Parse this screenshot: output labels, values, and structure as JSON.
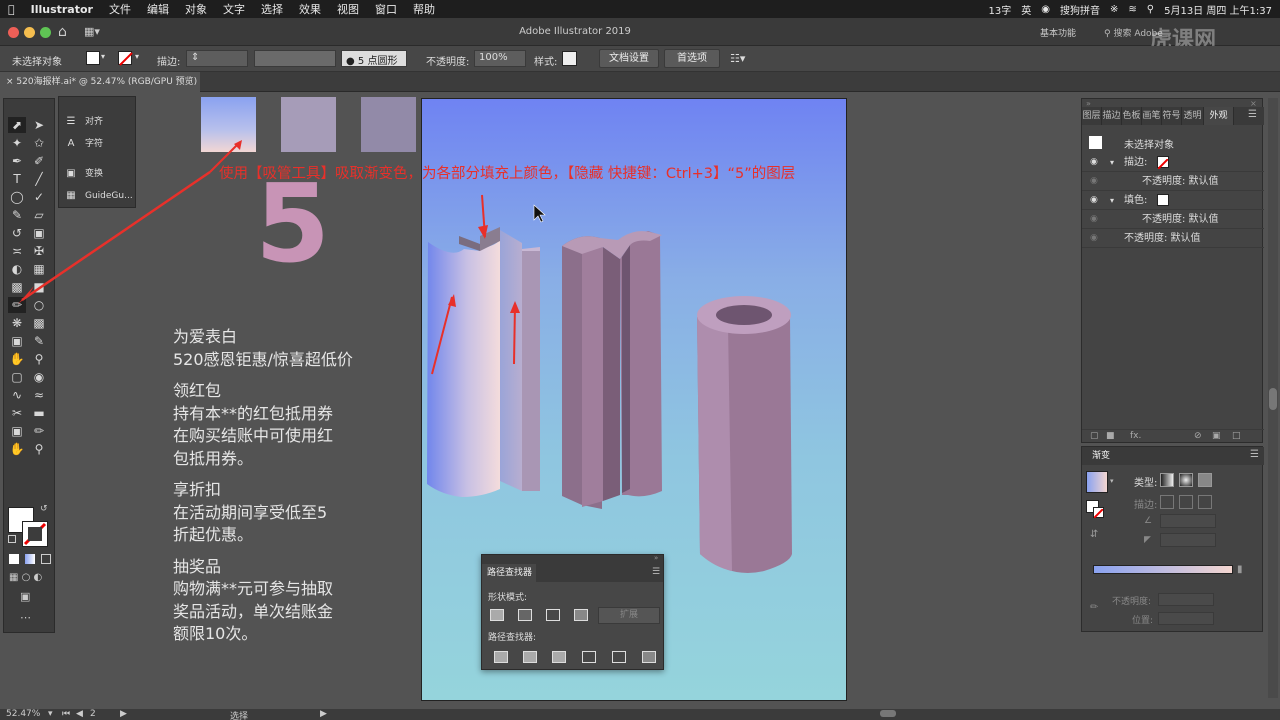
{
  "menubar": {
    "app": "Illustrator",
    "items": [
      "文件",
      "编辑",
      "对象",
      "文字",
      "选择",
      "效果",
      "视图",
      "窗口",
      "帮助"
    ],
    "status_input": "13字",
    "status_lang": "英",
    "sogou": "搜狗拼音",
    "datetime": "5月13日 周四 上午1:37"
  },
  "window": {
    "title": "Adobe Illustrator 2019",
    "workspace": "基本功能",
    "search_placeholder": "搜索 Adobe"
  },
  "control_bar": {
    "selection": "未选择对象",
    "stroke_label": "描边:",
    "brush": "5 点圆形",
    "opacity_label": "不透明度:",
    "opacity_value": "100%",
    "style_label": "样式:",
    "doc_setup": "文档设置",
    "preferences": "首选项"
  },
  "doc_tab": {
    "label": "520海报样.ai* @ 52.47% (RGB/GPU 预览)"
  },
  "flyout": {
    "items": [
      {
        "icon": "align-icon",
        "label": "对齐"
      },
      {
        "icon": "character-icon",
        "label": "字符"
      },
      {
        "icon": "transform-icon",
        "label": "变换"
      },
      {
        "icon": "guide-icon",
        "label": "GuideGu..."
      }
    ]
  },
  "artwork": {
    "big_number": "5",
    "swatch_colors": [
      "#8aa2f0",
      "#a69cb8",
      "#928aa8"
    ]
  },
  "annotation": "使用【吸管工具】吸取渐变色，为各部分填充上颜色，【隐藏 快捷键：Ctrl+3】“5”的图层",
  "poster_text": [
    {
      "lines": [
        "为爱表白",
        "520感恩钜惠/惊喜超低价"
      ]
    },
    {
      "lines": [
        "领红包",
        "持有本**的红包抵用券",
        "在购买结账中可使用红",
        "包抵用券。"
      ]
    },
    {
      "lines": [
        "享折扣",
        "在活动期间享受低至5",
        "折起优惠。"
      ]
    },
    {
      "lines": [
        "抽奖品",
        "购物满**元可参与抽取",
        "奖品活动，单次结账金",
        "额限10次。"
      ]
    }
  ],
  "appearance_panel": {
    "tabs": [
      "图层",
      "描边",
      "色板",
      "画笔",
      "符号",
      "透明",
      "外观"
    ],
    "active_tab": "外观",
    "header": "未选择对象",
    "rows": [
      {
        "label": "描边:",
        "indent": false
      },
      {
        "label": "不透明度: 默认值",
        "indent": true
      },
      {
        "label": "填色:",
        "indent": false
      },
      {
        "label": "不透明度: 默认值",
        "indent": true
      },
      {
        "label": "不透明度: 默认值",
        "indent": false
      }
    ],
    "fx": "fx."
  },
  "gradient_panel": {
    "title": "渐变",
    "type_label": "类型:",
    "stroke_label": "描边:",
    "opacity_label": "不透明度:",
    "position_label": "位置:",
    "start_color": "#8aa2f0",
    "end_color": "#f4d6d0"
  },
  "pathfinder": {
    "title": "路径查找器",
    "shape_modes": "形状模式:",
    "expand": "扩展",
    "pathfinders": "路径查找器:"
  },
  "statusbar": {
    "zoom": "52.47%",
    "page": "2",
    "tool": "选择"
  },
  "watermark": "虎课网"
}
